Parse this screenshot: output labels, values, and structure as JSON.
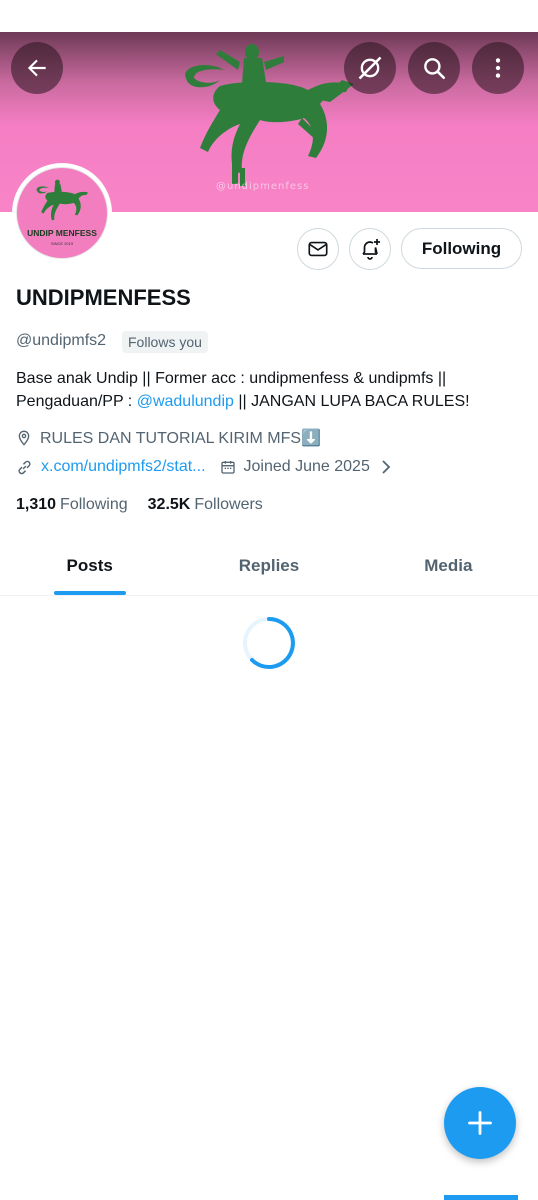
{
  "header": {
    "back_icon": "arrow-left-icon",
    "grok_icon": "grok-icon",
    "search_icon": "search-icon",
    "more_icon": "more-vertical-icon",
    "banner_watermark": "@undipmenfess"
  },
  "avatar": {
    "title": "UNDIP MENFESS",
    "subtitle": "SINCE 2019"
  },
  "actions": {
    "message_icon": "mail-icon",
    "notify_icon": "bell-plus-icon",
    "following_label": "Following"
  },
  "profile": {
    "display_name": "UNDIPMENFESS",
    "handle": "@undipmfs2",
    "follows_you": "Follows you",
    "bio_part1": "Base anak Undip || Former acc : undipmenfess & undipmfs || Pengaduan/PP : ",
    "bio_mention": "@wadulundip",
    "bio_part2": " || JANGAN LUPA BACA RULES!",
    "location": "RULES DAN TUTORIAL KIRIM MFS⬇️",
    "website": "x.com/undipmfs2/stat...",
    "joined": "Joined June 2025"
  },
  "stats": {
    "following_count": "1,310",
    "following_label": "Following",
    "followers_count": "32.5K",
    "followers_label": "Followers"
  },
  "tabs": [
    {
      "label": "Posts",
      "active": true
    },
    {
      "label": "Replies",
      "active": false
    },
    {
      "label": "Media",
      "active": false
    }
  ],
  "fab": {
    "icon": "plus-icon"
  },
  "colors": {
    "accent": "#1d9bf0",
    "banner_pink": "#f884c7",
    "logo_green": "#2e7d3a"
  }
}
